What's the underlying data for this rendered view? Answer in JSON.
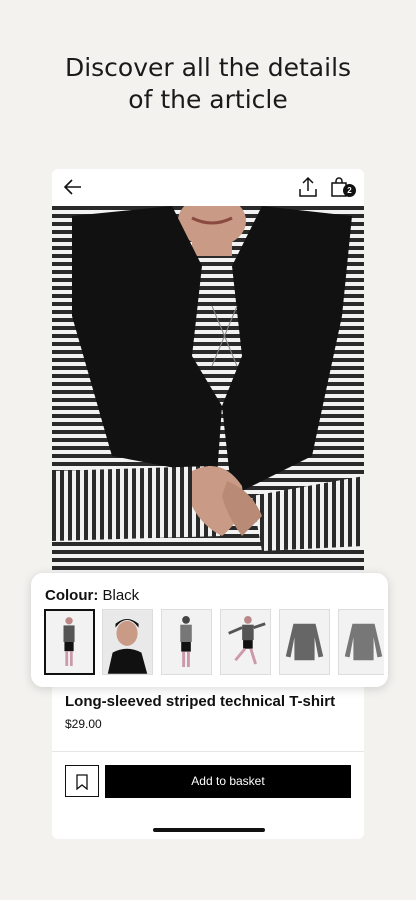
{
  "headline": {
    "line1": "Discover all the details",
    "line2": "of the article"
  },
  "topbar": {
    "bag_count": "2"
  },
  "icons": {
    "back": "arrow-left-icon",
    "share": "share-upload-icon",
    "bag": "shopping-bag-icon",
    "wishlist": "bookmark-icon"
  },
  "colour": {
    "label": "Colour",
    "separator": ":",
    "value": "Black"
  },
  "product": {
    "title": "Long-sleeved striped technical T-shirt",
    "price": "$29.00"
  },
  "actions": {
    "add_to_basket": "Add to basket"
  },
  "thumbnails": [
    "front-view",
    "portrait-view",
    "back-view",
    "running-pose",
    "flat-lay-front",
    "flat-lay-back"
  ]
}
